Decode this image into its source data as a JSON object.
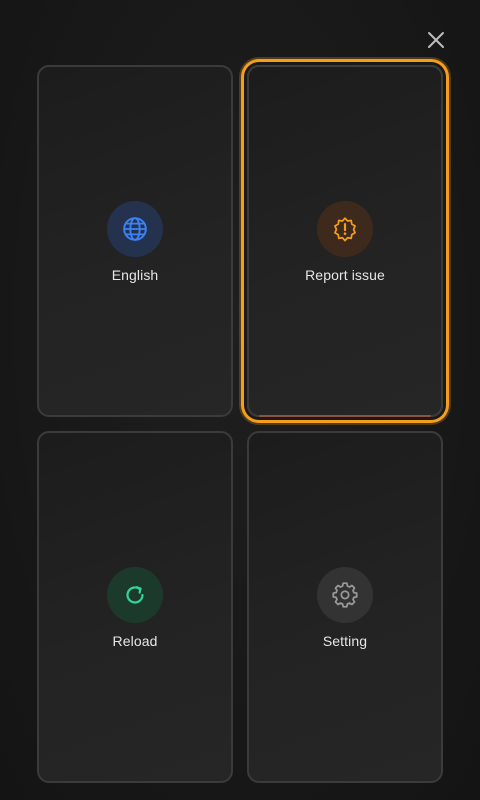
{
  "menu": {
    "close_icon": "close-icon",
    "tiles": [
      {
        "key": "english",
        "label": "English",
        "icon": "globe-icon",
        "accent": "#3b82f6",
        "icon_bg": "#24324d",
        "selected": false
      },
      {
        "key": "report",
        "label": "Report issue",
        "icon": "alert-badge-icon",
        "accent": "#f59e1c",
        "icon_bg": "#3e2a1c",
        "selected": true
      },
      {
        "key": "reload",
        "label": "Reload",
        "icon": "refresh-icon",
        "accent": "#34d399",
        "icon_bg": "#1c3a2c",
        "selected": false
      },
      {
        "key": "setting",
        "label": "Setting",
        "icon": "gear-icon",
        "accent": "#9a9a9a",
        "icon_bg": "#333333",
        "selected": false
      }
    ]
  },
  "colors": {
    "background": "#171717",
    "tile_border": "#3b3b3b",
    "selection": "#f59e1c",
    "text": "#e6e6e6"
  }
}
